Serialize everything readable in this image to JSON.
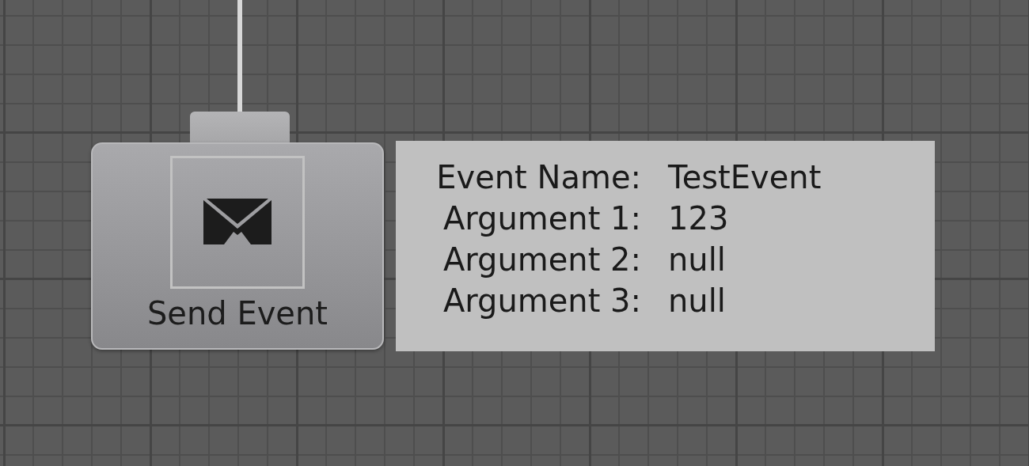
{
  "node": {
    "title": "Send Event"
  },
  "properties": [
    {
      "label": "Event Name:",
      "value": "TestEvent"
    },
    {
      "label": "Argument 1:",
      "value": "123"
    },
    {
      "label": "Argument 2:",
      "value": "null"
    },
    {
      "label": "Argument 3:",
      "value": "null"
    }
  ]
}
